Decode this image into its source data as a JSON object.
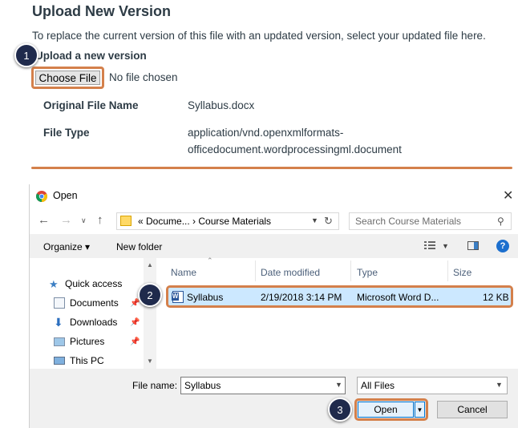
{
  "upload": {
    "heading": "Upload New Version",
    "description": "To replace the current version of this file with an updated version, select your updated file here.",
    "field_label": "Upload a new version",
    "choose_button": "Choose File",
    "no_file": "No file chosen",
    "original_name_label": "Original File Name",
    "original_name_value": "Syllabus.docx",
    "file_type_label": "File Type",
    "file_type_line1": "application/vnd.openxmlformats-",
    "file_type_line2": "officedocument.wordprocessingml.document"
  },
  "steps": [
    "1",
    "2",
    "3"
  ],
  "dialog": {
    "title": "Open",
    "close_glyph": "✕",
    "address": "«  Docume...  ›  Course Materials",
    "search_placeholder": "Search Course Materials",
    "toolbar": {
      "organize": "Organize ▾",
      "new_folder": "New folder",
      "help": "?"
    },
    "nav": [
      {
        "label": "Quick access",
        "icon": "star-icon"
      },
      {
        "label": "Documents",
        "icon": "documents-icon"
      },
      {
        "label": "Downloads",
        "icon": "downloads-icon"
      },
      {
        "label": "Pictures",
        "icon": "pictures-icon"
      },
      {
        "label": "This PC",
        "icon": "computer-icon"
      }
    ],
    "columns": [
      "Name",
      "Date modified",
      "Type",
      "Size"
    ],
    "file": {
      "name": "Syllabus",
      "date": "2/19/2018 3:14 PM",
      "type": "Microsoft Word D...",
      "size": "12 KB"
    },
    "file_name_label": "File name:",
    "file_name_value": "Syllabus",
    "filter": "All Files",
    "open_button": "Open",
    "cancel_button": "Cancel"
  },
  "colors": {
    "highlight": "#d4804b",
    "badge": "#1f2a4c",
    "selection": "#cce8ff"
  }
}
